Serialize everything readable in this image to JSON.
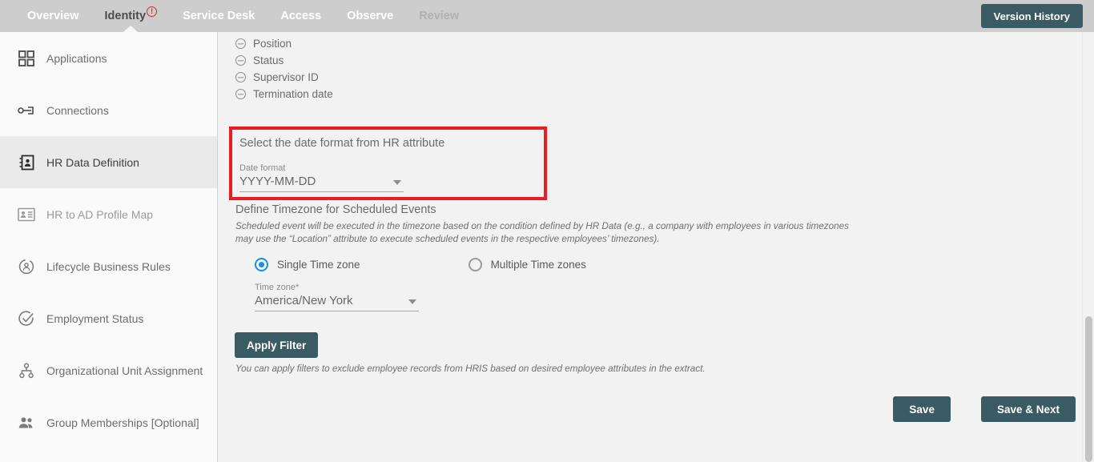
{
  "topnav": {
    "tabs": [
      {
        "label": "Overview",
        "state": "normal"
      },
      {
        "label": "Identity",
        "state": "active",
        "badge": "!"
      },
      {
        "label": "Service Desk",
        "state": "normal"
      },
      {
        "label": "Access",
        "state": "normal"
      },
      {
        "label": "Observe",
        "state": "normal"
      },
      {
        "label": "Review",
        "state": "muted"
      }
    ],
    "version_history_label": "Version History",
    "background_color": "#cdcdcd",
    "accent_color": "#3a5a64",
    "badge_color": "#e8212a"
  },
  "sidebar": {
    "items": [
      {
        "label": "Applications",
        "icon": "grid-icon",
        "state": "normal"
      },
      {
        "label": "Connections",
        "icon": "connection-icon",
        "state": "normal"
      },
      {
        "label": "HR Data Definition",
        "icon": "contact-card-icon",
        "state": "selected"
      },
      {
        "label": "HR to AD Profile Map",
        "icon": "id-card-icon",
        "state": "dim"
      },
      {
        "label": "Lifecycle Business Rules",
        "icon": "lifecycle-user-icon",
        "state": "normal"
      },
      {
        "label": "Employment Status",
        "icon": "check-circle-icon",
        "state": "normal"
      },
      {
        "label": "Organizational Unit Assignment",
        "icon": "org-tree-icon",
        "state": "normal"
      },
      {
        "label": "Group Memberships [Optional]",
        "icon": "people-icon",
        "state": "normal"
      }
    ]
  },
  "main": {
    "attributes": [
      {
        "label": "Position"
      },
      {
        "label": "Status"
      },
      {
        "label": "Supervisor ID"
      },
      {
        "label": "Termination date"
      }
    ],
    "date_format_section": {
      "title": "Select the date format from HR attribute",
      "field_label": "Date format",
      "value": "YYYY-MM-DD",
      "highlight_color": "#ec1c24"
    },
    "timezone_section": {
      "title": "Define Timezone for Scheduled Events",
      "description": "Scheduled event will be executed in the timezone based on the condition defined by HR Data (e.g., a company with employees in various timezones may use the “Location” attribute to execute scheduled events in the respective employees’ timezones).",
      "options": [
        {
          "label": "Single Time zone",
          "selected": true
        },
        {
          "label": "Multiple Time zones",
          "selected": false
        }
      ],
      "timezone_field_label": "Time zone*",
      "timezone_value": "America/New York",
      "selected_color": "#1592e6"
    },
    "apply_filter_label": "Apply Filter",
    "apply_filter_note": "You can apply filters to exclude employee records from HRIS based on desired employee attributes in the extract."
  },
  "footer": {
    "save_label": "Save",
    "save_next_label": "Save & Next"
  }
}
